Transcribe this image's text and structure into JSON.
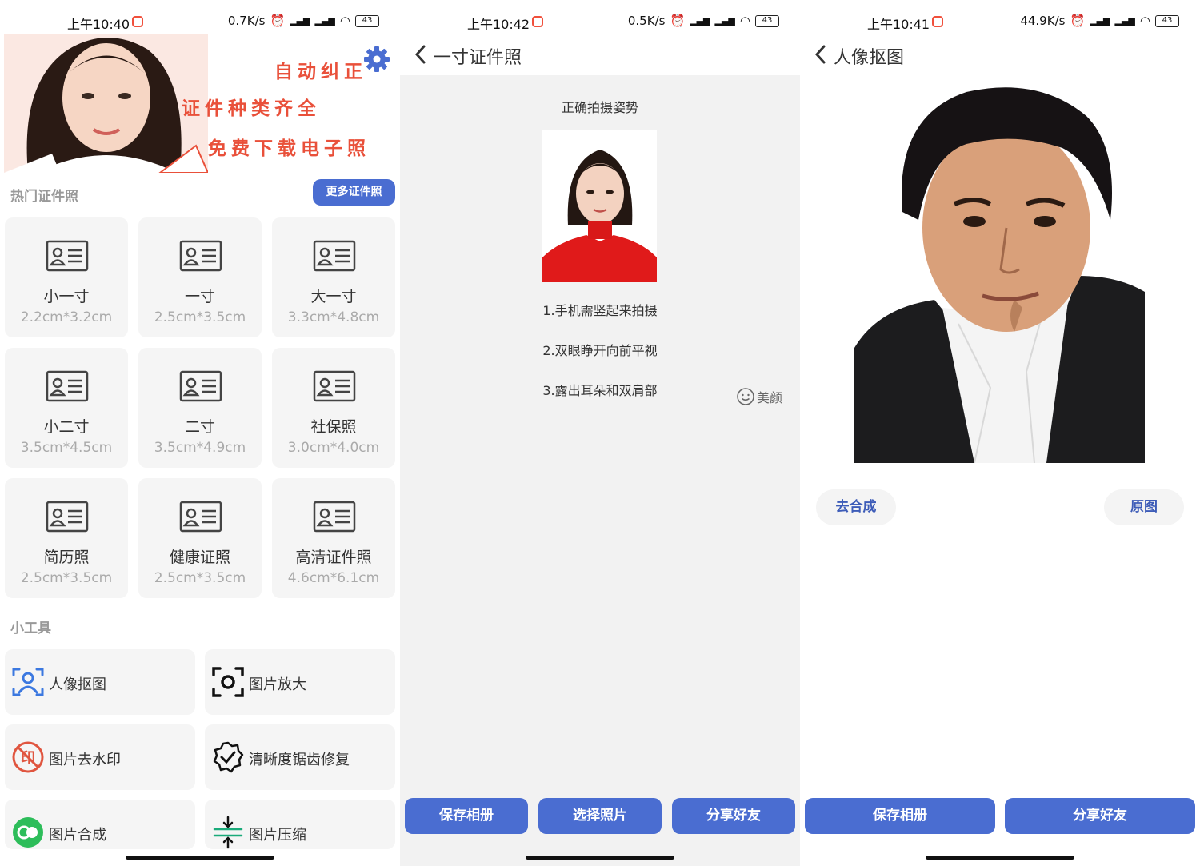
{
  "status_bars": [
    {
      "time": "上午10:40",
      "speed": "0.7K/s",
      "battery": "43"
    },
    {
      "time": "上午10:42",
      "speed": "0.5K/s",
      "battery": "43"
    },
    {
      "time": "上午10:41",
      "speed": "44.9K/s",
      "battery": "43"
    }
  ],
  "home": {
    "banner_lines": [
      "自动纠正",
      "证件种类齐全",
      "免费下载电子照"
    ],
    "hot_title": "热门证件照",
    "more_button": "更多证件照",
    "cards": [
      {
        "name": "小一寸",
        "size": "2.2cm*3.2cm"
      },
      {
        "name": "一寸",
        "size": "2.5cm*3.5cm"
      },
      {
        "name": "大一寸",
        "size": "3.3cm*4.8cm"
      },
      {
        "name": "小二寸",
        "size": "3.5cm*4.5cm"
      },
      {
        "name": "二寸",
        "size": "3.5cm*4.9cm"
      },
      {
        "name": "社保照",
        "size": "3.0cm*4.0cm"
      },
      {
        "name": "简历照",
        "size": "2.5cm*3.5cm"
      },
      {
        "name": "健康证照",
        "size": "2.5cm*3.5cm"
      },
      {
        "name": "高清证件照",
        "size": "4.6cm*6.1cm"
      }
    ],
    "tools_title": "小工具",
    "tools": [
      {
        "label": "人像抠图",
        "icon": "portrait-cutout-icon"
      },
      {
        "label": "图片放大",
        "icon": "image-enlarge-icon"
      },
      {
        "label": "图片去水印",
        "icon": "watermark-remove-icon"
      },
      {
        "label": "清晰度锯齿修复",
        "icon": "clarity-repair-icon"
      },
      {
        "label": "图片合成",
        "icon": "image-merge-icon"
      },
      {
        "label": "图片压缩",
        "icon": "image-compress-icon"
      }
    ]
  },
  "photo_guide": {
    "title": "一寸证件照",
    "pose_title": "正确拍摄姿势",
    "tips": [
      "1.手机需竖起来拍摄",
      "2.双眼睁开向前平视",
      "3.露出耳朵和双肩部"
    ],
    "beauty_label": "美颜",
    "buttons": {
      "save": "保存相册",
      "choose": "选择照片",
      "share": "分享好友"
    }
  },
  "cutout": {
    "title": "人像抠图",
    "compose_button": "去合成",
    "original_button": "原图",
    "buttons": {
      "save": "保存相册",
      "share": "分享好友"
    }
  },
  "colors": {
    "accent": "#4a6dd1",
    "banner_red": "#e9503a",
    "card_bg": "#f5f5f5"
  }
}
